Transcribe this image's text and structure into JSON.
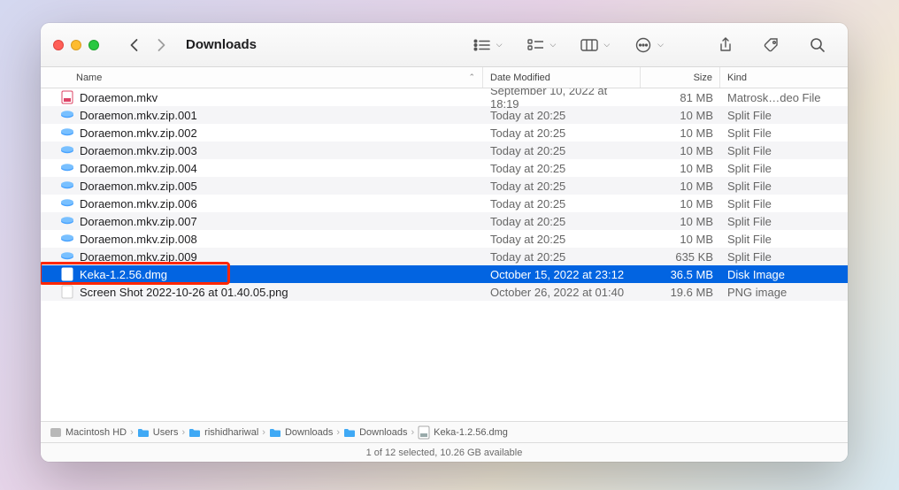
{
  "window": {
    "title": "Downloads"
  },
  "toolbar": {
    "icons": [
      "bullet-list-view",
      "square-list-view",
      "column-view",
      "ellipsis-circle",
      "share",
      "tag",
      "search"
    ]
  },
  "columns": {
    "name": "Name",
    "date": "Date Modified",
    "size": "Size",
    "kind": "Kind"
  },
  "files": [
    {
      "icon": "mkv",
      "name": "Doraemon.mkv",
      "date": "September 10, 2022 at 18:19",
      "size": "81 MB",
      "kind": "Matrosk…deo File"
    },
    {
      "icon": "split",
      "name": "Doraemon.mkv.zip.001",
      "date": "Today at 20:25",
      "size": "10 MB",
      "kind": "Split File"
    },
    {
      "icon": "split",
      "name": "Doraemon.mkv.zip.002",
      "date": "Today at 20:25",
      "size": "10 MB",
      "kind": "Split File"
    },
    {
      "icon": "split",
      "name": "Doraemon.mkv.zip.003",
      "date": "Today at 20:25",
      "size": "10 MB",
      "kind": "Split File"
    },
    {
      "icon": "split",
      "name": "Doraemon.mkv.zip.004",
      "date": "Today at 20:25",
      "size": "10 MB",
      "kind": "Split File"
    },
    {
      "icon": "split",
      "name": "Doraemon.mkv.zip.005",
      "date": "Today at 20:25",
      "size": "10 MB",
      "kind": "Split File"
    },
    {
      "icon": "split",
      "name": "Doraemon.mkv.zip.006",
      "date": "Today at 20:25",
      "size": "10 MB",
      "kind": "Split File"
    },
    {
      "icon": "split",
      "name": "Doraemon.mkv.zip.007",
      "date": "Today at 20:25",
      "size": "10 MB",
      "kind": "Split File"
    },
    {
      "icon": "split",
      "name": "Doraemon.mkv.zip.008",
      "date": "Today at 20:25",
      "size": "10 MB",
      "kind": "Split File"
    },
    {
      "icon": "split",
      "name": "Doraemon.mkv.zip.009",
      "date": "Today at 20:25",
      "size": "635 KB",
      "kind": "Split File"
    },
    {
      "icon": "dmg",
      "name": "Keka-1.2.56.dmg",
      "date": "October 15, 2022 at 23:12",
      "size": "36.5 MB",
      "kind": "Disk Image",
      "selected": true,
      "highlighted": true
    },
    {
      "icon": "png",
      "name": "Screen Shot 2022-10-26 at 01.40.05.png",
      "date": "October 26, 2022 at 01:40",
      "size": "19.6 MB",
      "kind": "PNG image"
    }
  ],
  "path": [
    {
      "icon": "disk",
      "label": "Macintosh HD"
    },
    {
      "icon": "folder",
      "label": "Users"
    },
    {
      "icon": "folder",
      "label": "rishidhariwal"
    },
    {
      "icon": "folder",
      "label": "Downloads"
    },
    {
      "icon": "folder",
      "label": "Downloads"
    },
    {
      "icon": "dmg",
      "label": "Keka-1.2.56.dmg"
    }
  ],
  "status": "1 of 12 selected, 10.26 GB available"
}
